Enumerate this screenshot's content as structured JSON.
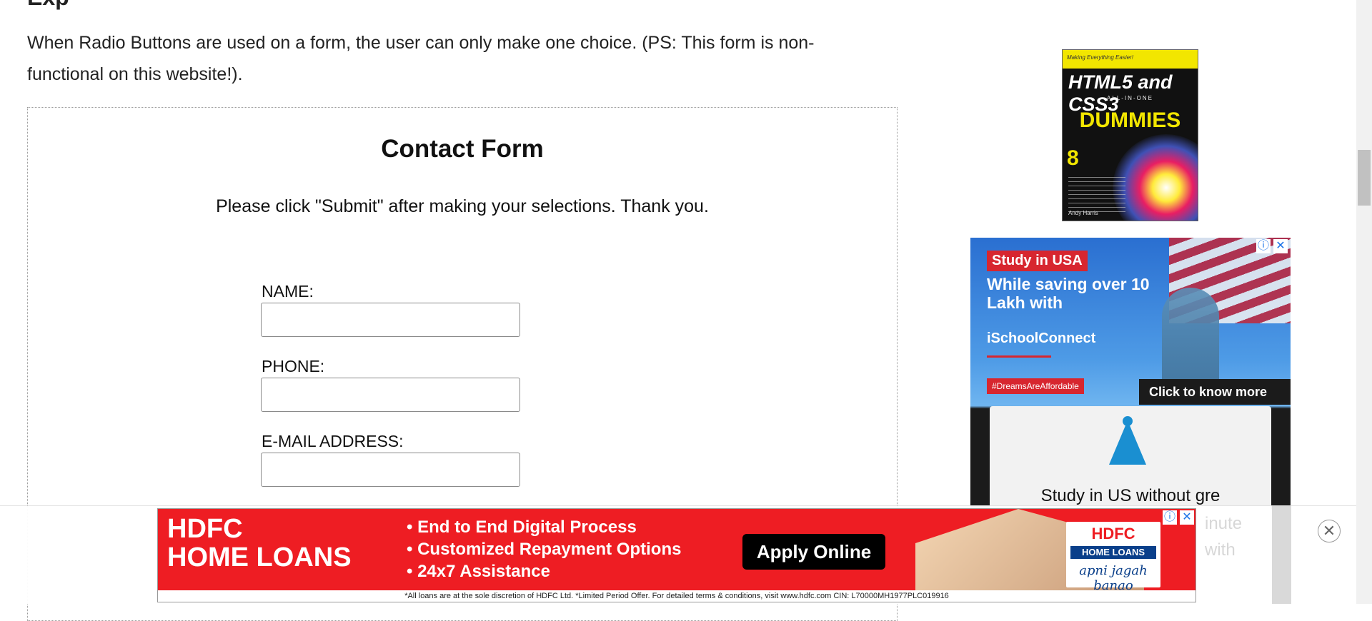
{
  "page": {
    "heading_partial": "Exp",
    "intro": "When Radio Buttons are used on a form, the user can only make one choice. (PS: This form is non-functional on this website!)."
  },
  "form": {
    "title": "Contact Form",
    "note": "Please click \"Submit\" after making your selections. Thank you.",
    "name_label": "NAME:",
    "phone_label": "PHONE:",
    "email_label": "E-MAIL ADDRESS:",
    "name_value": "",
    "phone_value": "",
    "email_value": ""
  },
  "sidebar": {
    "book": {
      "tag": "Making Everything Easier!",
      "title": "HTML5 and CSS3",
      "subtitle": "ALL-IN-ONE",
      "brand": "DUMMIES",
      "books": "8",
      "author": "Andy Harris"
    },
    "ad": {
      "badge": "Study in USA",
      "headline": "While saving over 10 Lakh with",
      "brand": "iSchoolConnect",
      "hashtag": "#DreamsAreAffordable",
      "cta": "Click to know more",
      "card_text": "Study in US without gre",
      "ghost_1": "inute",
      "ghost_2": "with",
      "info_icon": "info-icon",
      "close_icon": "close-icon"
    }
  },
  "bottom_ad": {
    "brand_line1": "HDFC",
    "brand_line2": "HOME LOANS",
    "bullets": [
      "• End to End Digital Process",
      "• Customized Repayment Options",
      "• 24x7 Assistance"
    ],
    "apply_button": "Apply Online",
    "logo_line1": "HDFC",
    "logo_line2": "HOME LOANS",
    "logo_tagline": "apni jagah banao",
    "disclaimer": "*All loans are at the sole discretion of HDFC Ltd. *Limited Period Offer. For detailed terms & conditions, visit www.hdfc.com   CIN: L70000MH1977PLC019916",
    "dismiss_symbol": "✕"
  }
}
